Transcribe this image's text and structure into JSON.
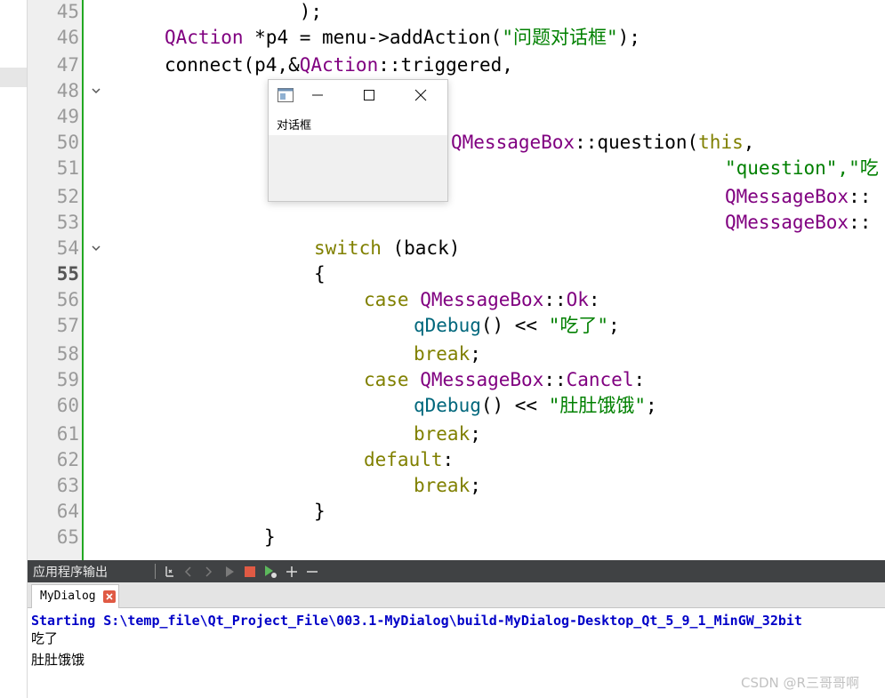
{
  "editor": {
    "line_numbers": [
      "45",
      "46",
      "47",
      "48",
      "49",
      "50",
      "51",
      "52",
      "53",
      "54",
      "55",
      "56",
      "57",
      "58",
      "59",
      "60",
      "61",
      "62",
      "63",
      "64",
      "65"
    ],
    "current_line": "55",
    "fold_markers": [
      "48",
      "54"
    ],
    "lines": {
      "l45": {
        "a": "            );"
      },
      "l46": {
        "type": "QAction",
        "rest": " *p4 = menu->addAction(",
        "str": "\"问题对话框\"",
        "end": ");"
      },
      "l47": {
        "a": "connect(p4,&",
        "type": "QAction",
        "b": "::triggered,"
      },
      "l48": {
        "a": "            ["
      },
      "l49": {
        "a": "            {"
      },
      "l50": {
        "type": "QMessageBox",
        "a": "::question(",
        "kw": "this",
        "b": ","
      },
      "l51": {
        "str": "\"question\",\"吃"
      },
      "l52": {
        "type": "QMessageBox",
        "b": "::"
      },
      "l53": {
        "type": "QMessageBox",
        "b": "::"
      },
      "l54": {
        "kw": "switch",
        "b": " (back)"
      },
      "l55": {
        "a": "{"
      },
      "l56": {
        "kw": "case",
        "type": "QMessageBox",
        "a": "::",
        "type2": "Ok",
        "b": ":"
      },
      "l57": {
        "fn": "qDebug",
        "a": "() << ",
        "str": "\"吃了\"",
        "b": ";"
      },
      "l58": {
        "kw": "break",
        "b": ";"
      },
      "l59": {
        "kw": "case",
        "type": "QMessageBox",
        "a": "::",
        "type2": "Cancel",
        "b": ":"
      },
      "l60": {
        "fn": "qDebug",
        "a": "() << ",
        "str": "\"肚肚饿饿\"",
        "b": ";"
      },
      "l61": {
        "kw": "break",
        "b": ";"
      },
      "l62": {
        "kw": "default",
        "b": ":"
      },
      "l63": {
        "kw": "break",
        "b": ";"
      },
      "l64": {
        "a": "}"
      },
      "l65": {
        "a": "}"
      }
    }
  },
  "popup": {
    "title": "对话框",
    "icon": "app-window-icon",
    "buttons": [
      "minimize-icon",
      "maximize-icon",
      "close-icon"
    ]
  },
  "output": {
    "title": "应用程序输出",
    "toolbar_icons": [
      "attach-debugger-icon",
      "prev-icon",
      "next-icon",
      "run-icon",
      "stop-icon",
      "debug-run-icon",
      "zoom-in-icon",
      "zoom-out-icon"
    ],
    "tab_label": "MyDialog",
    "lines": [
      "Starting S:\\temp_file\\Qt_Project_File\\003.1-MyDialog\\build-MyDialog-Desktop_Qt_5_9_1_MinGW_32bit",
      "吃了",
      "肚肚饿饿"
    ]
  },
  "watermark": "CSDN @R三哥哥啊",
  "colors": {
    "type": "#800080",
    "keyword": "#808000",
    "string": "#008000",
    "function": "#00677c",
    "output_header": "#404244",
    "starting_text": "#0000c8",
    "change_bar": "#22a822"
  }
}
